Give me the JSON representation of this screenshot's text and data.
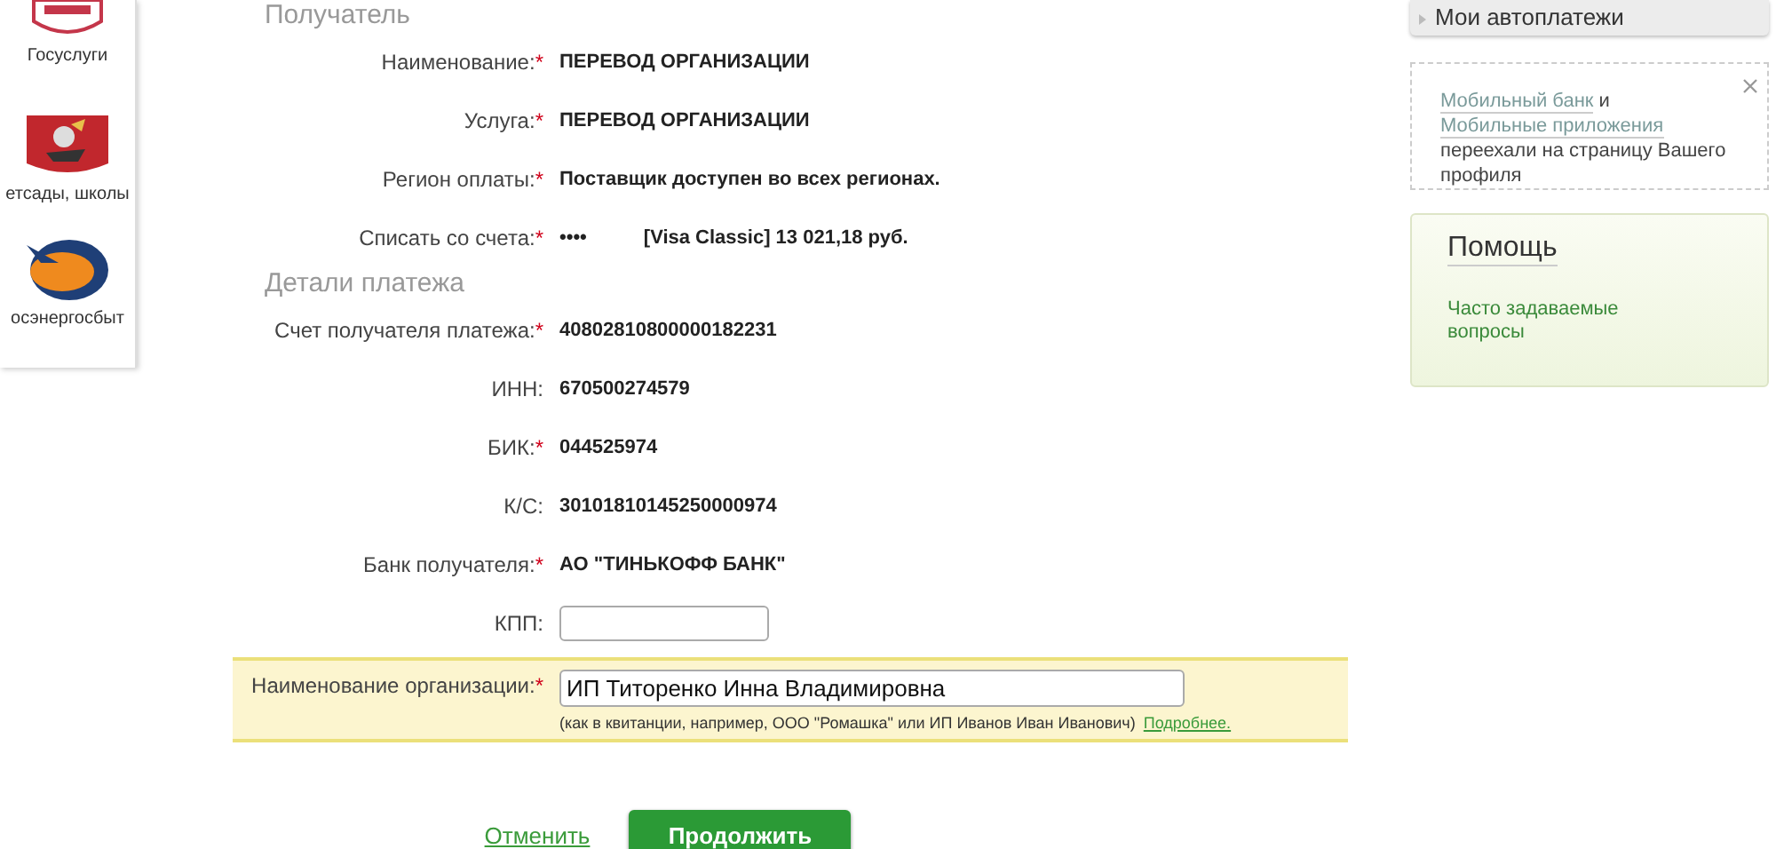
{
  "sidebar": {
    "items": [
      {
        "label": "Госуслуги",
        "kind": "shield"
      },
      {
        "label": "етсады, школы",
        "kind": "coat"
      },
      {
        "label": "осэнергосбыт",
        "kind": "energy"
      }
    ]
  },
  "recipient": {
    "heading": "Получатель",
    "rows": [
      {
        "label": "Наименование:",
        "required_mark": "*",
        "value": "ПЕРЕВОД ОРГАНИЗАЦИИ"
      },
      {
        "label": "Услуга:",
        "required_mark": "*",
        "value": "ПЕРЕВОД ОРГАНИЗАЦИИ"
      },
      {
        "label": "Регион оплаты:",
        "required_mark": "*",
        "value": "Поставщик доступен во всех регионах."
      },
      {
        "label": "Списать со счета:",
        "required_mark": "*",
        "value": "••••",
        "value_2": "[Visa Classic] 13 021,18   руб."
      }
    ]
  },
  "details": {
    "heading": "Детали платежа",
    "rows": [
      {
        "label": "Счет получателя платежа:",
        "required_mark": "*",
        "kind": "text",
        "value": "40802810800000182231"
      },
      {
        "label": "ИНН:",
        "kind": "text",
        "value": "670500274579"
      },
      {
        "label": "БИК:",
        "required_mark": "*",
        "kind": "text",
        "value": "044525974"
      },
      {
        "label": "К/С:",
        "kind": "text",
        "value": "30101810145250000974"
      },
      {
        "label": "Банк получателя:",
        "required_mark": "*",
        "kind": "text",
        "value": "АО \"ТИНЬКОФФ БАНК\""
      },
      {
        "label": "КПП:",
        "kind": "input"
      },
      {
        "label": "Наименование организации:",
        "required_mark": "*",
        "kind": "highlighted-input",
        "value": "ИП Титоренко Инна Владимировна",
        "hint": "(как в квитанции, например, ООО \"Ромашка\" или ИП Иванов Иван Иванович)",
        "hint_link": "Подробнее."
      }
    ]
  },
  "actions": {
    "cancel": "Отменить",
    "submit": "Продолжить"
  },
  "right": {
    "autopay": "Мои автоплатежи",
    "notice": {
      "link_1": "Мобильный банк",
      "text_1": "и",
      "link_2": "Мобильные приложения",
      "text_2": "переехали на страницу Вашего профиля"
    },
    "help": {
      "title": "Помощь",
      "link": "Часто задаваемые вопросы"
    }
  }
}
